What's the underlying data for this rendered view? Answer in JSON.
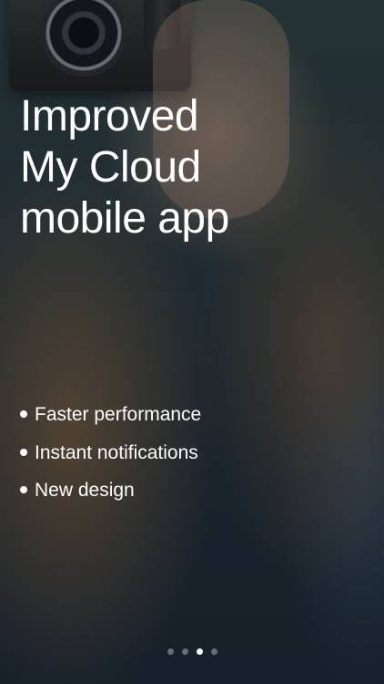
{
  "headline": {
    "lines": [
      "Improved",
      "My Cloud",
      "mobile app"
    ]
  },
  "features": [
    {
      "label": "Faster performance"
    },
    {
      "label": "Instant notifications"
    },
    {
      "label": "New design"
    }
  ],
  "pagination": {
    "count": 4,
    "active_index": 2
  },
  "colors": {
    "text": "#ffffff",
    "dot_inactive": "rgba(255,255,255,0.35)",
    "dot_active": "#ffffff"
  }
}
